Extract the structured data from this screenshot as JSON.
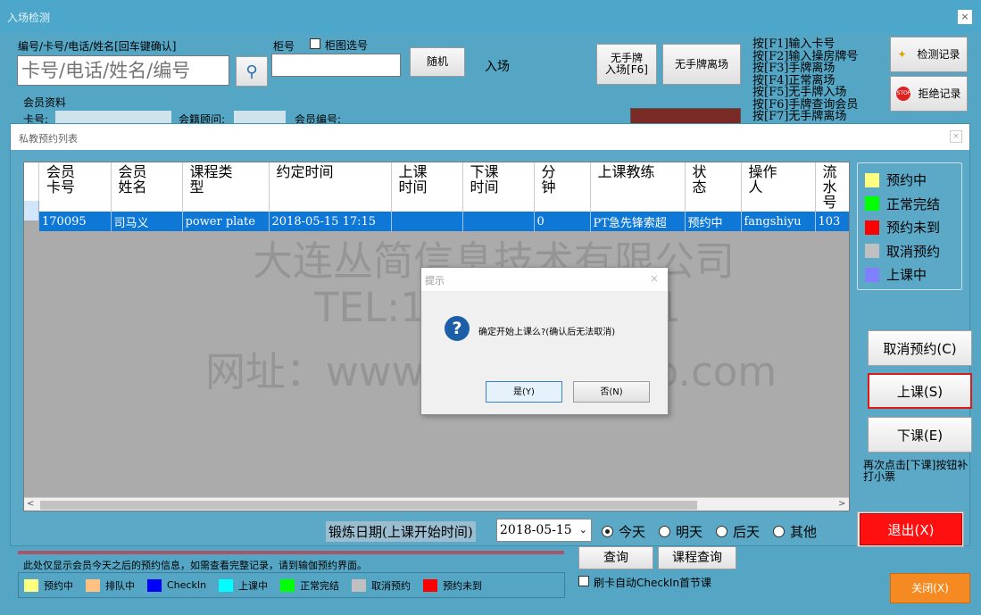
{
  "window": {
    "title": "入场检测"
  },
  "top": {
    "search_label": "编号/卡号/电话/姓名[回车键确认]",
    "search_placeholder": "卡号/电话/姓名/编号",
    "locker_label": "柜号",
    "pick_checkbox_label": "柜图选号",
    "random_button": "随机",
    "enter_label": "入场",
    "no_plate_enter_button": "无手牌\n入场[F6]",
    "no_plate_leave_button": "无手牌离场",
    "member_info_label": "会员资料",
    "card_label": "卡号:",
    "advisor_label": "会籍顾问:",
    "member_no_label": "会员编号:"
  },
  "shortcuts": [
    "按[F1]输入卡号",
    "按[F2]输入操房牌号",
    "按[F3]手牌离场",
    "按[F4]正常离场",
    "按[F5]无手牌入场",
    "按[F6]手牌查询会员",
    "按[F7]无手牌离场"
  ],
  "right_buttons": {
    "check_record": "检测记录",
    "reject_record": "拒绝记录"
  },
  "dialog": {
    "title": "私教预约列表"
  },
  "table": {
    "headers": [
      "会员\n卡号",
      "会员\n姓名",
      "课程类\n型",
      "约定时间",
      "上课\n时间",
      "下课\n时间",
      "分\n钟",
      "上课教练",
      "状\n态",
      "操作\n人",
      "流水\n号"
    ],
    "rows": [
      [
        "170095",
        "司马义",
        "power plate",
        "2018-05-15 17:15",
        "",
        "",
        "0",
        "PT急先锋索超",
        "预约中",
        "fangshiyu",
        "103"
      ]
    ]
  },
  "legend": [
    {
      "label": "预约中",
      "color": "#ffff80"
    },
    {
      "label": "正常完结",
      "color": "#00ff00"
    },
    {
      "label": "预约未到",
      "color": "#ff0000"
    },
    {
      "label": "取消预约",
      "color": "#c0c0c0"
    },
    {
      "label": "上课中",
      "color": "#8080ff"
    }
  ],
  "actions": {
    "cancel": "取消预约(C)",
    "start": "上课(S)",
    "end": "下课(E)",
    "reprint_note": "再次点击[下课]按钮补打小票",
    "exit": "退出(X)"
  },
  "date_bar": {
    "label": "锻炼日期(上课开始时间)",
    "date": "2018-05-15",
    "options": [
      "今天",
      "明天",
      "后天",
      "其他"
    ]
  },
  "watermark": {
    "company": "大连丛简信息技术有限公司",
    "tel": "TEL:13478428141",
    "site": "网址：www.congjianinfo.com"
  },
  "prompt": {
    "title": "提示",
    "message": "确定开始上课么?(确认后无法取消)",
    "yes": "是(Y)",
    "no": "否(N)"
  },
  "bottom": {
    "note": "此处仅显示会员今天之后的预约信息，如需查看完整记录，请到输伽预约界面。",
    "legend": [
      {
        "label": "预约中",
        "color": "#ffff80"
      },
      {
        "label": "排队中",
        "color": "#ffc080"
      },
      {
        "label": "CheckIn",
        "color": "#0000ff"
      },
      {
        "label": "上课中",
        "color": "#00ffff"
      },
      {
        "label": "正常完结",
        "color": "#00ff00"
      },
      {
        "label": "取消预约",
        "color": "#c0c0c0"
      },
      {
        "label": "预约未到",
        "color": "#ff0000"
      }
    ],
    "query_button": "查询",
    "course_query_button": "课程查询",
    "auto_checkin_label": "刷卡自动CheckIn首节课",
    "close_button": "关闭(X)"
  }
}
